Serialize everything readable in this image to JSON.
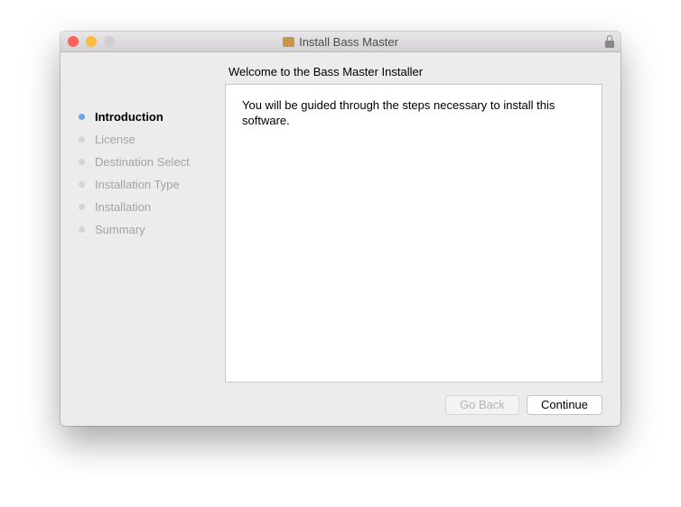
{
  "window": {
    "title": "Install Bass Master"
  },
  "heading": "Welcome to the Bass Master Installer",
  "body_text": "You will be guided through the steps necessary to install this software.",
  "steps": [
    {
      "label": "Introduction"
    },
    {
      "label": "License"
    },
    {
      "label": "Destination Select"
    },
    {
      "label": "Installation Type"
    },
    {
      "label": "Installation"
    },
    {
      "label": "Summary"
    }
  ],
  "buttons": {
    "back": "Go Back",
    "continue": "Continue"
  }
}
